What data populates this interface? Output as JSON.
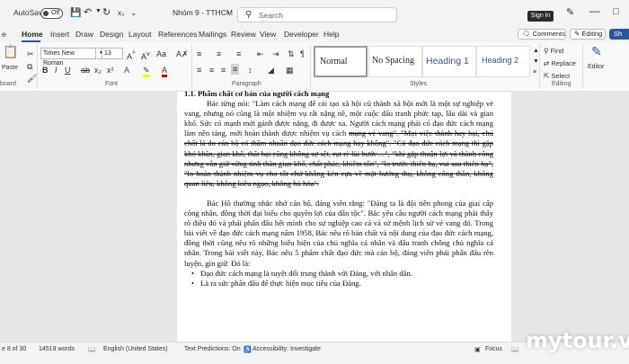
{
  "titlebar": {
    "autosave": "AutoSave",
    "toggle": "Off",
    "doc_title": "Nhóm 9 - TTHCM",
    "search_placeholder": "Search",
    "signin": "Sign in"
  },
  "menu": {
    "tabs": [
      "e",
      "Home",
      "Insert",
      "Draw",
      "Design",
      "Layout",
      "References",
      "Mailings",
      "Review",
      "View",
      "Developer",
      "Help"
    ],
    "comments": "Comments",
    "editing": "Editing",
    "share": "Sh"
  },
  "ribbon": {
    "font_name": "Times New Roman",
    "font_size": "13",
    "paste_label": "Paste",
    "groups": {
      "clipboard": "board",
      "font": "Font",
      "paragraph": "Paragraph",
      "styles": "Styles",
      "editing": "Editing"
    },
    "styles": [
      "Normal",
      "No Spacing",
      "Heading 1",
      "Heading 2"
    ],
    "find": "Find",
    "replace": "Replace",
    "select": "Select",
    "editor": "Editor"
  },
  "document": {
    "heading": "1.1. Phẩm chất cơ bản của người cách mạng",
    "p1": "Bác từng nói: \"Làm cách mạng để cải tạo xã hội cũ thành xã hội mới là một sự nghiệp vẻ vang, nhưng nó cũng là một nhiệm vụ rất nặng nề, một cuộc đấu tranh phức tạp, lâu dài và gian khổ. Sức có mạnh mới gánh được nặng, đi được xa. Người cách mạng phải có đạo đức cách mạng làm nền tảng, mới hoàn thành được nhiệm vụ cách",
    "p1_strike": "mạng vẻ vang\". \"Mọi việc thành hay bại, chủ chốt là do cán bộ có thấm nhuần đạo đức cách mạng hay không\". \"Có đạo đức cách mạng thì gặp khó khăn, gian khổ, thất bại cũng không sợ sệt, rụt rè lùi bước…\", \"khi gặp thuận lợi và thành công nhưng vẫn giữ vững tinh thần gian khổ, chất phác, khiêm tốn\", \"lo trước thiên hạ, vui sau thiên hạ\", \"lo hoàn thành nhiệm vụ cho tốt chứ không kèn cựa về mặt hưởng thụ, không công thần, không quan liêu, không kiêu ngạo, không hủ hóa\".",
    "p2": "Bác Hồ thường nhắc nhở cán bộ, đảng viên rằng: \"Đảng ta là đội tiên phong của giai cấp công nhân, đồng thời đại biểu cho quyền lợi của dân tộc\". Bác yêu cầu người cách mạng phải thấy rõ điều đó và phải phấn đấu hết mình cho sự nghiệp cao cả và sứ mệnh lịch sử vẻ vang đó. Trong bài viết về đạo đức cách mạng năm 1958, Bác nêu rõ bản chất và nội dung của đạo đức cách mạng, đồng thời cũng nêu rõ những biểu hiện của chủ nghĩa cá nhân và đấu tranh chống chủ nghĩa cá nhân. Trong bài viết này, Bác nêu 5 phẩm chất đạo đức mà cán bộ, đảng viên phải phấn đấu rèn luyện, gìn giữ. Đó là:",
    "bullets": [
      "Đạo đức cách mạng là tuyệt đối trung thành với Đảng, với nhân dân.",
      "Là ra sức phấn đấu để thực hiện mục tiêu của Đảng."
    ]
  },
  "status": {
    "page": "e 8 of 30",
    "words": "14519 words",
    "language": "English (United States)",
    "predictions": "Text Predictions: On",
    "accessibility": "Accessibility: Investigate",
    "focus": "Focus"
  },
  "watermark": "mytour.vn"
}
